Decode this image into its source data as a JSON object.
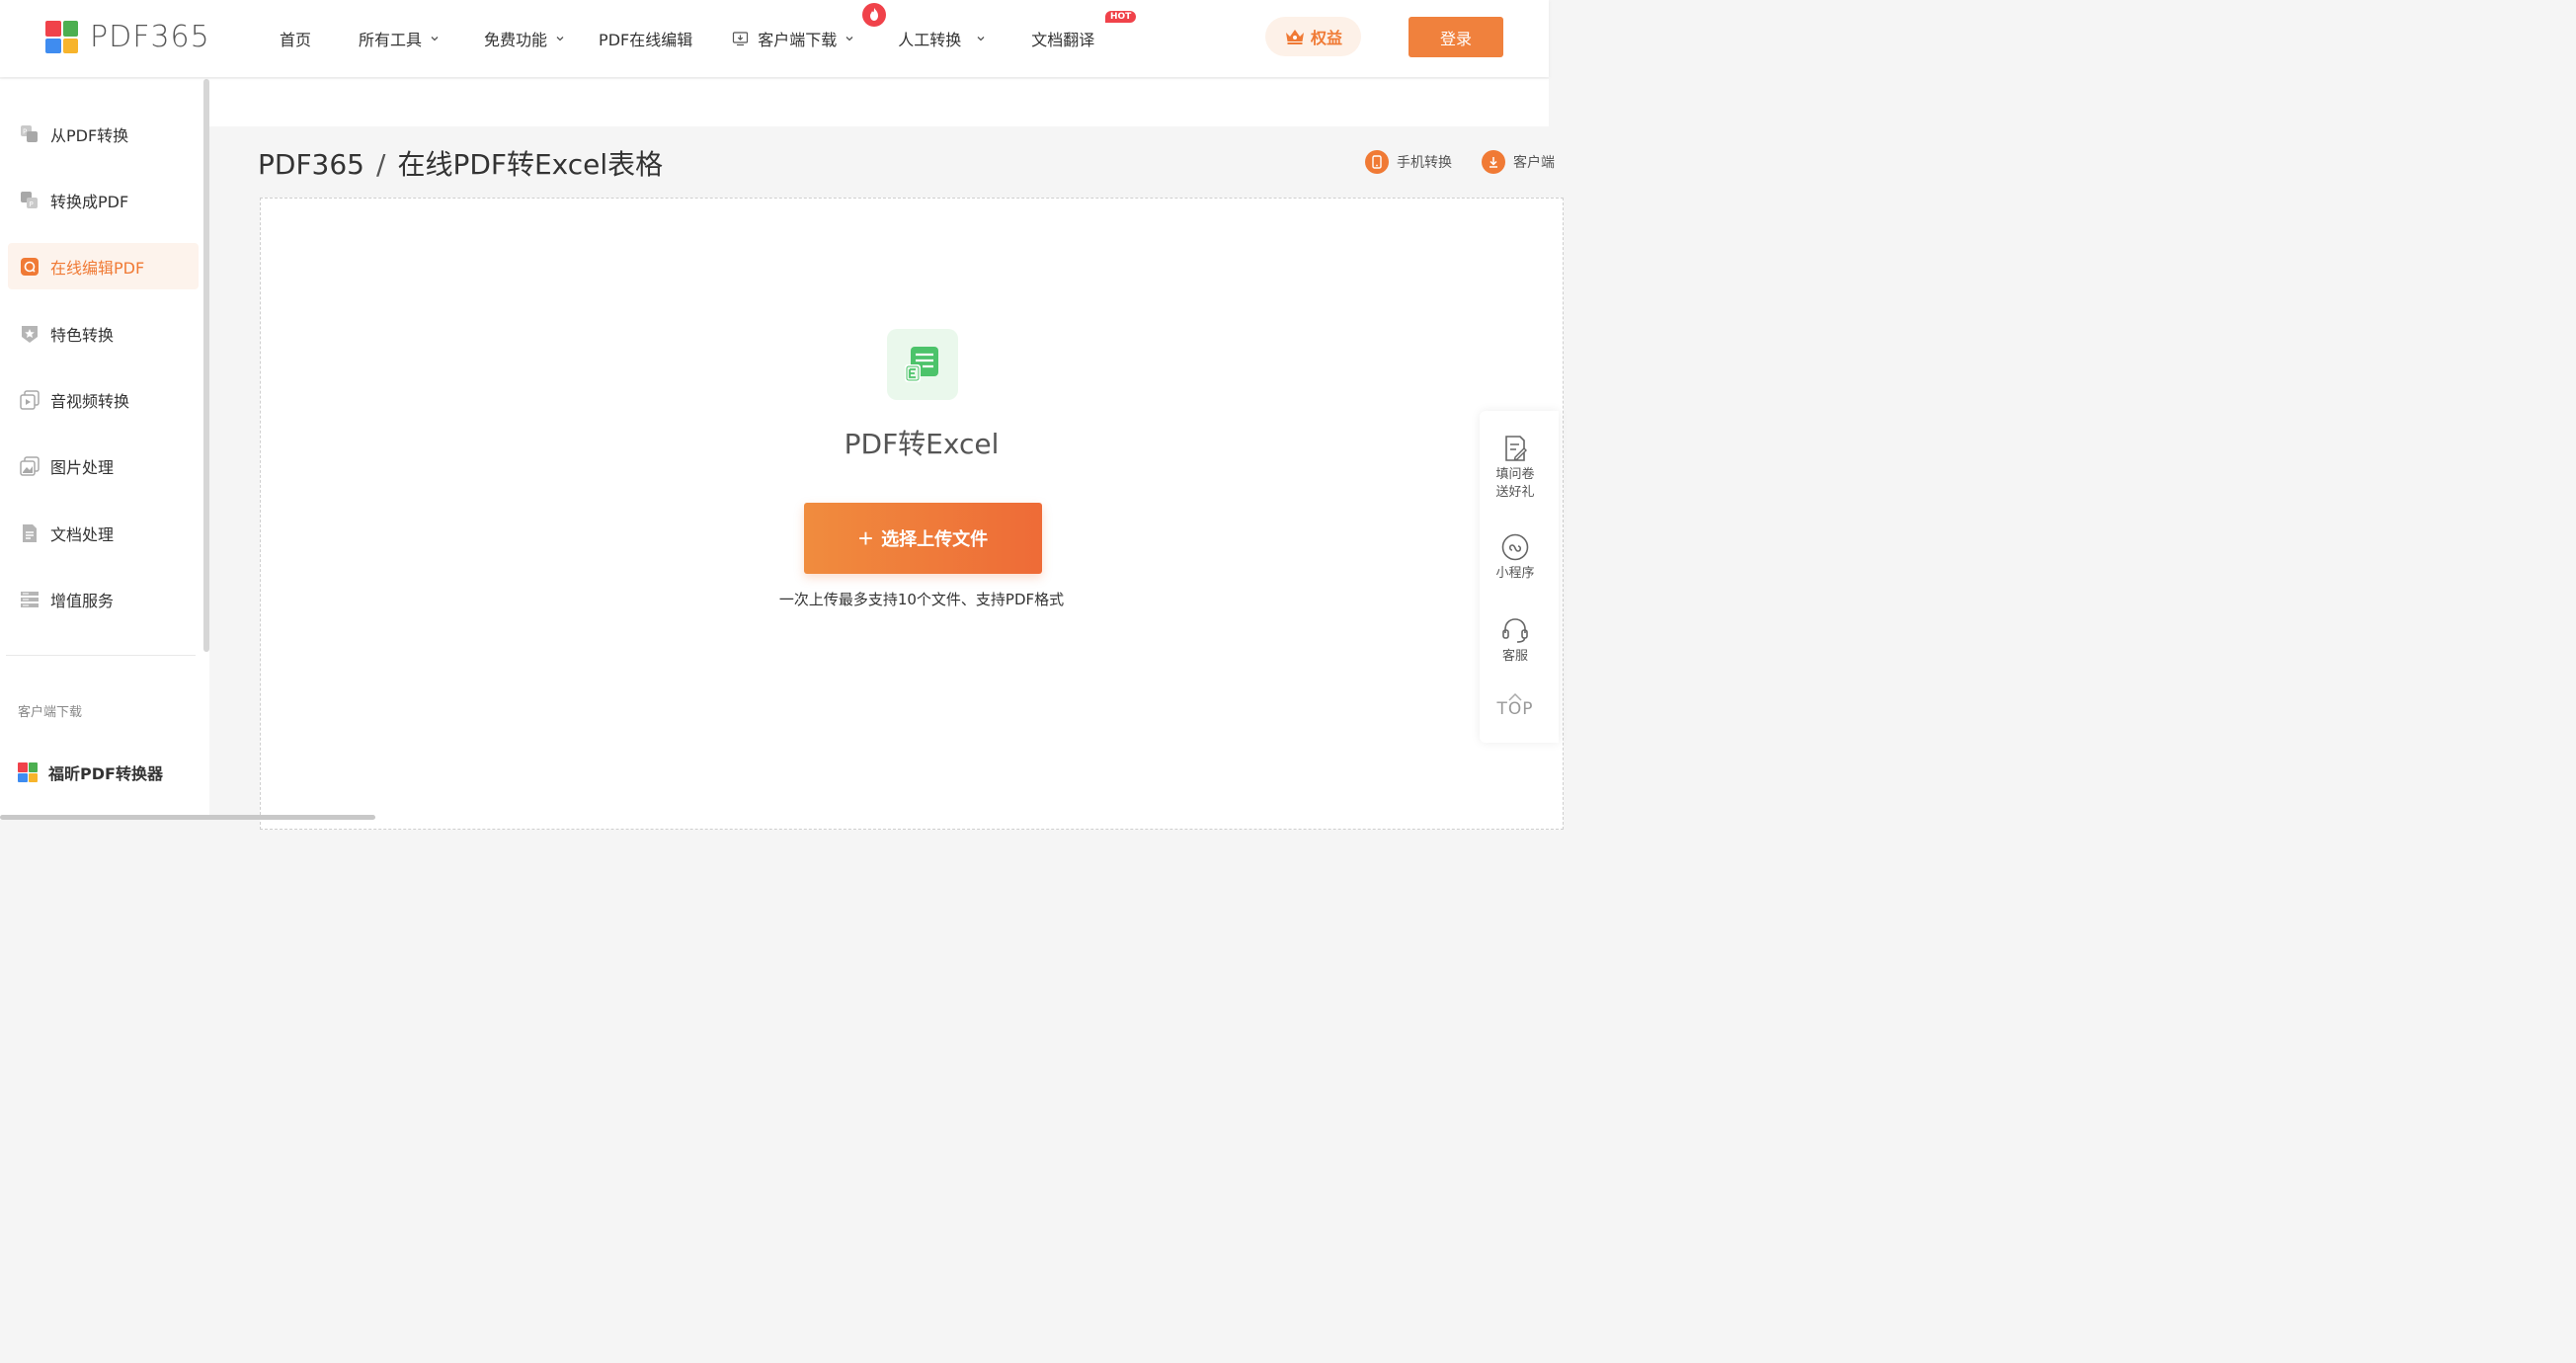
{
  "header": {
    "logo_text": "PDF365",
    "nav": [
      {
        "label": "首页",
        "has_dropdown": false
      },
      {
        "label": "所有工具",
        "has_dropdown": true
      },
      {
        "label": "免费功能",
        "has_dropdown": true
      },
      {
        "label": "PDF在线编辑",
        "has_dropdown": false
      },
      {
        "label": "客户端下载",
        "has_dropdown": true,
        "icon": "download-icon"
      },
      {
        "label": "人工转换",
        "has_dropdown": true,
        "badge_icon": "fire-icon"
      },
      {
        "label": "文档翻译",
        "has_dropdown": false,
        "badge": "HOT"
      }
    ],
    "benefit_label": "权益",
    "login_label": "登录"
  },
  "sidebar": {
    "items": [
      {
        "label": "从PDF转换",
        "icon": "pdf-convert-from-icon",
        "active": false
      },
      {
        "label": "转换成PDF",
        "icon": "pdf-convert-to-icon",
        "active": false
      },
      {
        "label": "在线编辑PDF",
        "icon": "edit-pdf-icon",
        "active": true
      },
      {
        "label": "特色转换",
        "icon": "special-convert-icon",
        "active": false
      },
      {
        "label": "音视频转换",
        "icon": "media-convert-icon",
        "active": false
      },
      {
        "label": "图片处理",
        "icon": "image-process-icon",
        "active": false
      },
      {
        "label": "文档处理",
        "icon": "document-process-icon",
        "active": false
      },
      {
        "label": "增值服务",
        "icon": "value-service-icon",
        "active": false
      }
    ],
    "download_label": "客户端下载",
    "app_name": "福昕PDF转换器"
  },
  "main": {
    "breadcrumb_root": "PDF365",
    "breadcrumb_sep": "/",
    "breadcrumb_page": "在线PDF转Excel表格",
    "links": [
      {
        "label": "手机转换",
        "icon": "mobile-icon"
      },
      {
        "label": "客户端",
        "icon": "client-icon"
      }
    ],
    "tool_title": "PDF转Excel",
    "upload_label": "选择上传文件",
    "upload_plus": "+",
    "upload_hint": "一次上传最多支持10个文件、支持PDF格式"
  },
  "float_bar": {
    "survey_label_1": "填问卷",
    "survey_label_2": "送好礼",
    "miniprogram_label": "小程序",
    "service_label": "客服",
    "top_label": "TOP"
  },
  "colors": {
    "accent": "#f07a35",
    "excel_green": "#4cc36a"
  }
}
